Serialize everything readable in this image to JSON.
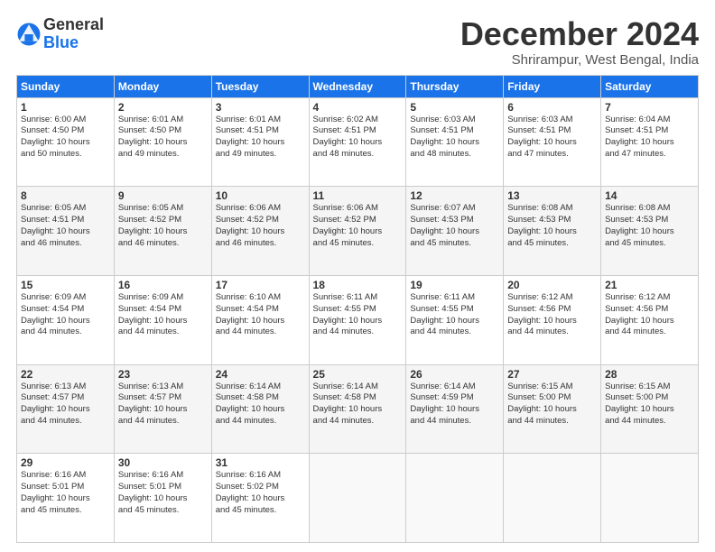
{
  "logo": {
    "line1": "General",
    "line2": "Blue"
  },
  "title": "December 2024",
  "subtitle": "Shrirampur, West Bengal, India",
  "days_header": [
    "Sunday",
    "Monday",
    "Tuesday",
    "Wednesday",
    "Thursday",
    "Friday",
    "Saturday"
  ],
  "weeks": [
    [
      {
        "day": "1",
        "info": "Sunrise: 6:00 AM\nSunset: 4:50 PM\nDaylight: 10 hours\nand 50 minutes."
      },
      {
        "day": "2",
        "info": "Sunrise: 6:01 AM\nSunset: 4:50 PM\nDaylight: 10 hours\nand 49 minutes."
      },
      {
        "day": "3",
        "info": "Sunrise: 6:01 AM\nSunset: 4:51 PM\nDaylight: 10 hours\nand 49 minutes."
      },
      {
        "day": "4",
        "info": "Sunrise: 6:02 AM\nSunset: 4:51 PM\nDaylight: 10 hours\nand 48 minutes."
      },
      {
        "day": "5",
        "info": "Sunrise: 6:03 AM\nSunset: 4:51 PM\nDaylight: 10 hours\nand 48 minutes."
      },
      {
        "day": "6",
        "info": "Sunrise: 6:03 AM\nSunset: 4:51 PM\nDaylight: 10 hours\nand 47 minutes."
      },
      {
        "day": "7",
        "info": "Sunrise: 6:04 AM\nSunset: 4:51 PM\nDaylight: 10 hours\nand 47 minutes."
      }
    ],
    [
      {
        "day": "8",
        "info": "Sunrise: 6:05 AM\nSunset: 4:51 PM\nDaylight: 10 hours\nand 46 minutes."
      },
      {
        "day": "9",
        "info": "Sunrise: 6:05 AM\nSunset: 4:52 PM\nDaylight: 10 hours\nand 46 minutes."
      },
      {
        "day": "10",
        "info": "Sunrise: 6:06 AM\nSunset: 4:52 PM\nDaylight: 10 hours\nand 46 minutes."
      },
      {
        "day": "11",
        "info": "Sunrise: 6:06 AM\nSunset: 4:52 PM\nDaylight: 10 hours\nand 45 minutes."
      },
      {
        "day": "12",
        "info": "Sunrise: 6:07 AM\nSunset: 4:53 PM\nDaylight: 10 hours\nand 45 minutes."
      },
      {
        "day": "13",
        "info": "Sunrise: 6:08 AM\nSunset: 4:53 PM\nDaylight: 10 hours\nand 45 minutes."
      },
      {
        "day": "14",
        "info": "Sunrise: 6:08 AM\nSunset: 4:53 PM\nDaylight: 10 hours\nand 45 minutes."
      }
    ],
    [
      {
        "day": "15",
        "info": "Sunrise: 6:09 AM\nSunset: 4:54 PM\nDaylight: 10 hours\nand 44 minutes."
      },
      {
        "day": "16",
        "info": "Sunrise: 6:09 AM\nSunset: 4:54 PM\nDaylight: 10 hours\nand 44 minutes."
      },
      {
        "day": "17",
        "info": "Sunrise: 6:10 AM\nSunset: 4:54 PM\nDaylight: 10 hours\nand 44 minutes."
      },
      {
        "day": "18",
        "info": "Sunrise: 6:11 AM\nSunset: 4:55 PM\nDaylight: 10 hours\nand 44 minutes."
      },
      {
        "day": "19",
        "info": "Sunrise: 6:11 AM\nSunset: 4:55 PM\nDaylight: 10 hours\nand 44 minutes."
      },
      {
        "day": "20",
        "info": "Sunrise: 6:12 AM\nSunset: 4:56 PM\nDaylight: 10 hours\nand 44 minutes."
      },
      {
        "day": "21",
        "info": "Sunrise: 6:12 AM\nSunset: 4:56 PM\nDaylight: 10 hours\nand 44 minutes."
      }
    ],
    [
      {
        "day": "22",
        "info": "Sunrise: 6:13 AM\nSunset: 4:57 PM\nDaylight: 10 hours\nand 44 minutes."
      },
      {
        "day": "23",
        "info": "Sunrise: 6:13 AM\nSunset: 4:57 PM\nDaylight: 10 hours\nand 44 minutes."
      },
      {
        "day": "24",
        "info": "Sunrise: 6:14 AM\nSunset: 4:58 PM\nDaylight: 10 hours\nand 44 minutes."
      },
      {
        "day": "25",
        "info": "Sunrise: 6:14 AM\nSunset: 4:58 PM\nDaylight: 10 hours\nand 44 minutes."
      },
      {
        "day": "26",
        "info": "Sunrise: 6:14 AM\nSunset: 4:59 PM\nDaylight: 10 hours\nand 44 minutes."
      },
      {
        "day": "27",
        "info": "Sunrise: 6:15 AM\nSunset: 5:00 PM\nDaylight: 10 hours\nand 44 minutes."
      },
      {
        "day": "28",
        "info": "Sunrise: 6:15 AM\nSunset: 5:00 PM\nDaylight: 10 hours\nand 44 minutes."
      }
    ],
    [
      {
        "day": "29",
        "info": "Sunrise: 6:16 AM\nSunset: 5:01 PM\nDaylight: 10 hours\nand 45 minutes."
      },
      {
        "day": "30",
        "info": "Sunrise: 6:16 AM\nSunset: 5:01 PM\nDaylight: 10 hours\nand 45 minutes."
      },
      {
        "day": "31",
        "info": "Sunrise: 6:16 AM\nSunset: 5:02 PM\nDaylight: 10 hours\nand 45 minutes."
      },
      {
        "day": "",
        "info": ""
      },
      {
        "day": "",
        "info": ""
      },
      {
        "day": "",
        "info": ""
      },
      {
        "day": "",
        "info": ""
      }
    ]
  ]
}
